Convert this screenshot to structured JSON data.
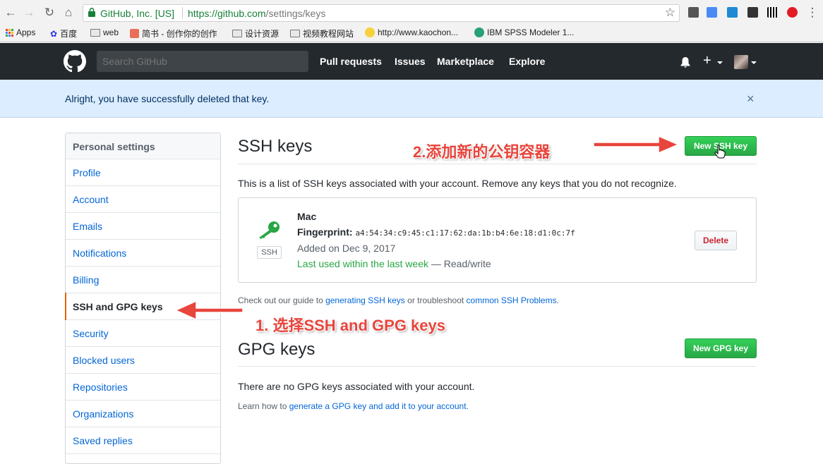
{
  "browser": {
    "org": "GitHub, Inc. [US]",
    "url_host": "https://github.com",
    "url_path": "/settings/keys",
    "bookmarks": [
      "Apps",
      "百度",
      "web",
      "简书 - 创作你的创作",
      "设计资源",
      "视频教程网站",
      "http://www.kaochon...",
      "IBM SPSS Modeler 1..."
    ]
  },
  "header": {
    "search_placeholder": "Search GitHub",
    "nav": [
      "Pull requests",
      "Issues",
      "Marketplace",
      "Explore"
    ],
    "plus": "+"
  },
  "flash": {
    "message": "Alright, you have successfully deleted that key.",
    "close": "×"
  },
  "sidebar": {
    "heading": "Personal settings",
    "items": [
      "Profile",
      "Account",
      "Emails",
      "Notifications",
      "Billing",
      "SSH and GPG keys",
      "Security",
      "Blocked users",
      "Repositories",
      "Organizations",
      "Saved replies"
    ],
    "active": "SSH and GPG keys"
  },
  "ssh": {
    "title": "SSH keys",
    "new_button": "New SSH key",
    "description": "This is a list of SSH keys associated with your account. Remove any keys that you do not recognize.",
    "key": {
      "name": "Mac",
      "fingerprint_label": "Fingerprint:",
      "fingerprint": "a4:54:34:c9:45:c1:17:62:da:1b:b4:6e:18:d1:0c:7f",
      "added": "Added on Dec 9, 2017",
      "last_used": "Last used within the last week",
      "access": "— Read/write",
      "badge": "SSH",
      "delete": "Delete"
    },
    "guide_prefix": "Check out our guide to ",
    "guide_link1": "generating SSH keys",
    "guide_mid": " or troubleshoot ",
    "guide_link2": "common SSH Problems",
    "guide_suffix": "."
  },
  "gpg": {
    "title": "GPG keys",
    "new_button": "New GPG key",
    "empty": "There are no GPG keys associated with your account.",
    "learn_prefix": "Learn how to ",
    "learn_link": "generate a GPG key and add it to your account",
    "learn_suffix": "."
  },
  "annotations": {
    "step1": "1. 选择SSH and GPG keys",
    "step2": "2.添加新的公钥容器",
    "color": "#e8453c"
  }
}
